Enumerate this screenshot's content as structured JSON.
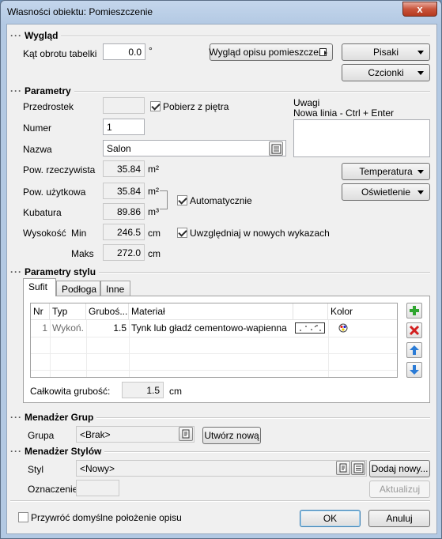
{
  "window": {
    "title": "Własności obiektu: Pomieszczenie",
    "close": "x"
  },
  "wyglad": {
    "title": "Wygląd",
    "kat_label": "Kąt obrotu tabelki",
    "kat_value": "0.0",
    "kat_unit": "°",
    "opis_button": "Wygląd opisu pomieszczeń",
    "pisaki": "Pisaki",
    "czcionki": "Czcionki"
  },
  "parametry": {
    "title": "Parametry",
    "przedrostek_label": "Przedrostek",
    "przedrostek_value": "",
    "pobierz_label": "Pobierz z piętra",
    "pobierz_checked": true,
    "uwagi_label": "Uwagi",
    "uwagi_hint": "Nowa linia - Ctrl + Enter",
    "uwagi_value": "",
    "numer_label": "Numer",
    "numer_value": "1",
    "nazwa_label": "Nazwa",
    "nazwa_value": "Salon",
    "pow_rzecz_label": "Pow. rzeczywista",
    "pow_rzecz_value": "35.84",
    "pow_rzecz_unit": "m²",
    "temperatura": "Temperatura",
    "oswietlenie": "Oświetlenie",
    "pow_uzyt_label": "Pow. użytkowa",
    "pow_uzyt_value": "35.84",
    "pow_uzyt_unit": "m²",
    "automatycznie_label": "Automatycznie",
    "automatycznie_checked": true,
    "kubatura_label": "Kubatura",
    "kubatura_value": "89.86",
    "kubatura_unit": "m³",
    "wysokosc_label": "Wysokość",
    "min_label": "Min",
    "min_value": "246.5",
    "min_unit": "cm",
    "maks_label": "Maks",
    "maks_value": "272.0",
    "maks_unit": "cm",
    "uwzgl_label": "Uwzględniaj w nowych wykazach",
    "uwzgl_checked": true
  },
  "styl": {
    "title": "Parametry stylu",
    "tabs": [
      "Sufit",
      "Podłoga",
      "Inne"
    ],
    "active_tab": 0,
    "columns": [
      "Nr",
      "Typ",
      "Gruboś...",
      "Materiał",
      "",
      "Kolor"
    ],
    "rows": [
      {
        "nr": "1",
        "typ": "Wykoń.",
        "grubosc": "1.5",
        "material": "Tynk lub gładź cementowo-wapienna"
      }
    ],
    "calkowita_label": "Całkowita grubość:",
    "calkowita_value": "1.5",
    "calkowita_unit": "cm"
  },
  "grupy": {
    "title": "Menadżer Grup",
    "grupa_label": "Grupa",
    "grupa_value": "<Brak>",
    "utworz": "Utwórz nową"
  },
  "style_mgr": {
    "title": "Menadżer Stylów",
    "styl_label": "Styl",
    "styl_value": "<Nowy>",
    "dodaj": "Dodaj nowy...",
    "oznaczenie_label": "Oznaczenie",
    "oznaczenie_value": "",
    "aktualizuj": "Aktualizuj"
  },
  "footer": {
    "przywroc_label": "Przywróć domyślne położenie opisu",
    "przywroc_checked": false,
    "ok": "OK",
    "anuluj": "Anuluj"
  },
  "colors": {
    "accent_green": "#2fa52f",
    "accent_red": "#d22020",
    "accent_blue": "#2a7bd6"
  }
}
